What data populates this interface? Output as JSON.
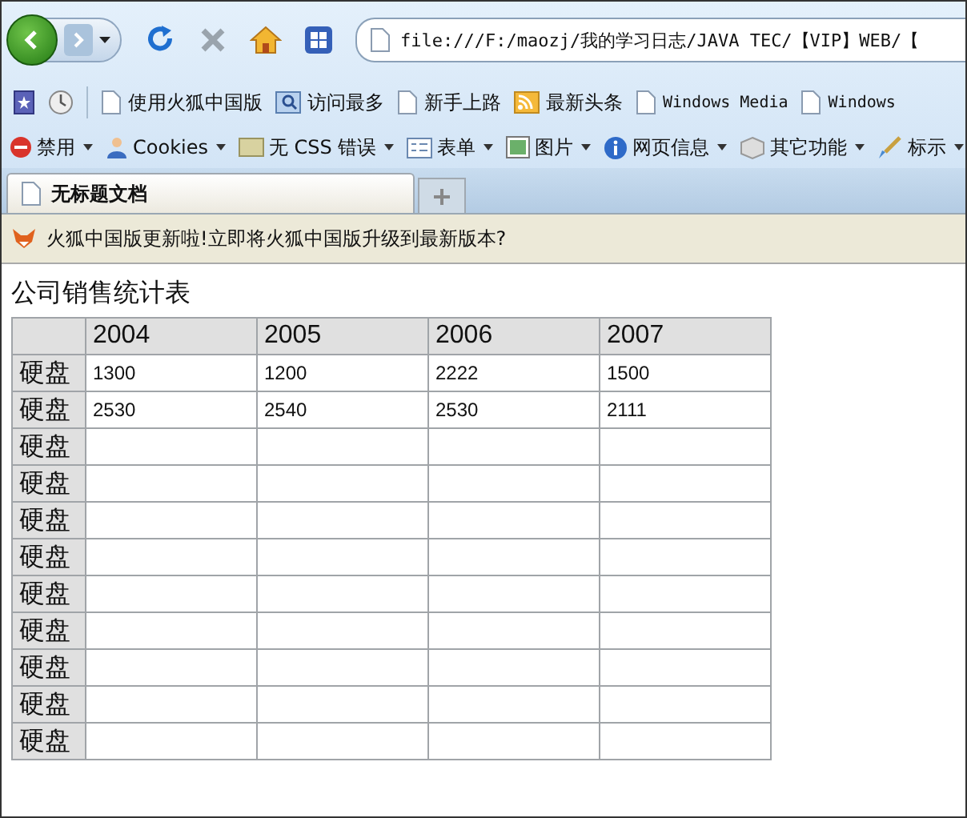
{
  "address_bar": {
    "value": "file:///F:/maozj/我的学习日志/JAVA TEC/【VIP】WEB/【"
  },
  "bookmarks": [
    {
      "label": "使用火狐中国版"
    },
    {
      "label": "访问最多"
    },
    {
      "label": "新手上路"
    },
    {
      "label": "最新头条"
    },
    {
      "label": "Windows Media"
    },
    {
      "label": "Windows"
    }
  ],
  "dev_toolbar": [
    {
      "label": "禁用"
    },
    {
      "label": "Cookies"
    },
    {
      "label": "无 CSS 错误"
    },
    {
      "label": "表单"
    },
    {
      "label": "图片"
    },
    {
      "label": "网页信息"
    },
    {
      "label": "其它功能"
    },
    {
      "label": "标示"
    }
  ],
  "tabs": [
    {
      "label": "无标题文档",
      "selected": true
    }
  ],
  "notification": {
    "text": "火狐中国版更新啦!立即将火狐中国版升级到最新版本?"
  },
  "page": {
    "title": "公司销售统计表",
    "table": {
      "columns": [
        "2004",
        "2005",
        "2006",
        "2007"
      ],
      "rows": [
        {
          "label": "硬盘",
          "cells": [
            "1300",
            "1200",
            "2222",
            "1500"
          ]
        },
        {
          "label": "硬盘",
          "cells": [
            "2530",
            "2540",
            "2530",
            "2111"
          ]
        },
        {
          "label": "硬盘",
          "cells": []
        },
        {
          "label": "硬盘",
          "cells": []
        },
        {
          "label": "硬盘",
          "cells": []
        },
        {
          "label": "硬盘",
          "cells": []
        },
        {
          "label": "硬盘",
          "cells": []
        },
        {
          "label": "硬盘",
          "cells": []
        },
        {
          "label": "硬盘",
          "cells": []
        },
        {
          "label": "硬盘",
          "cells": []
        },
        {
          "label": "硬盘",
          "cells": []
        }
      ]
    }
  }
}
